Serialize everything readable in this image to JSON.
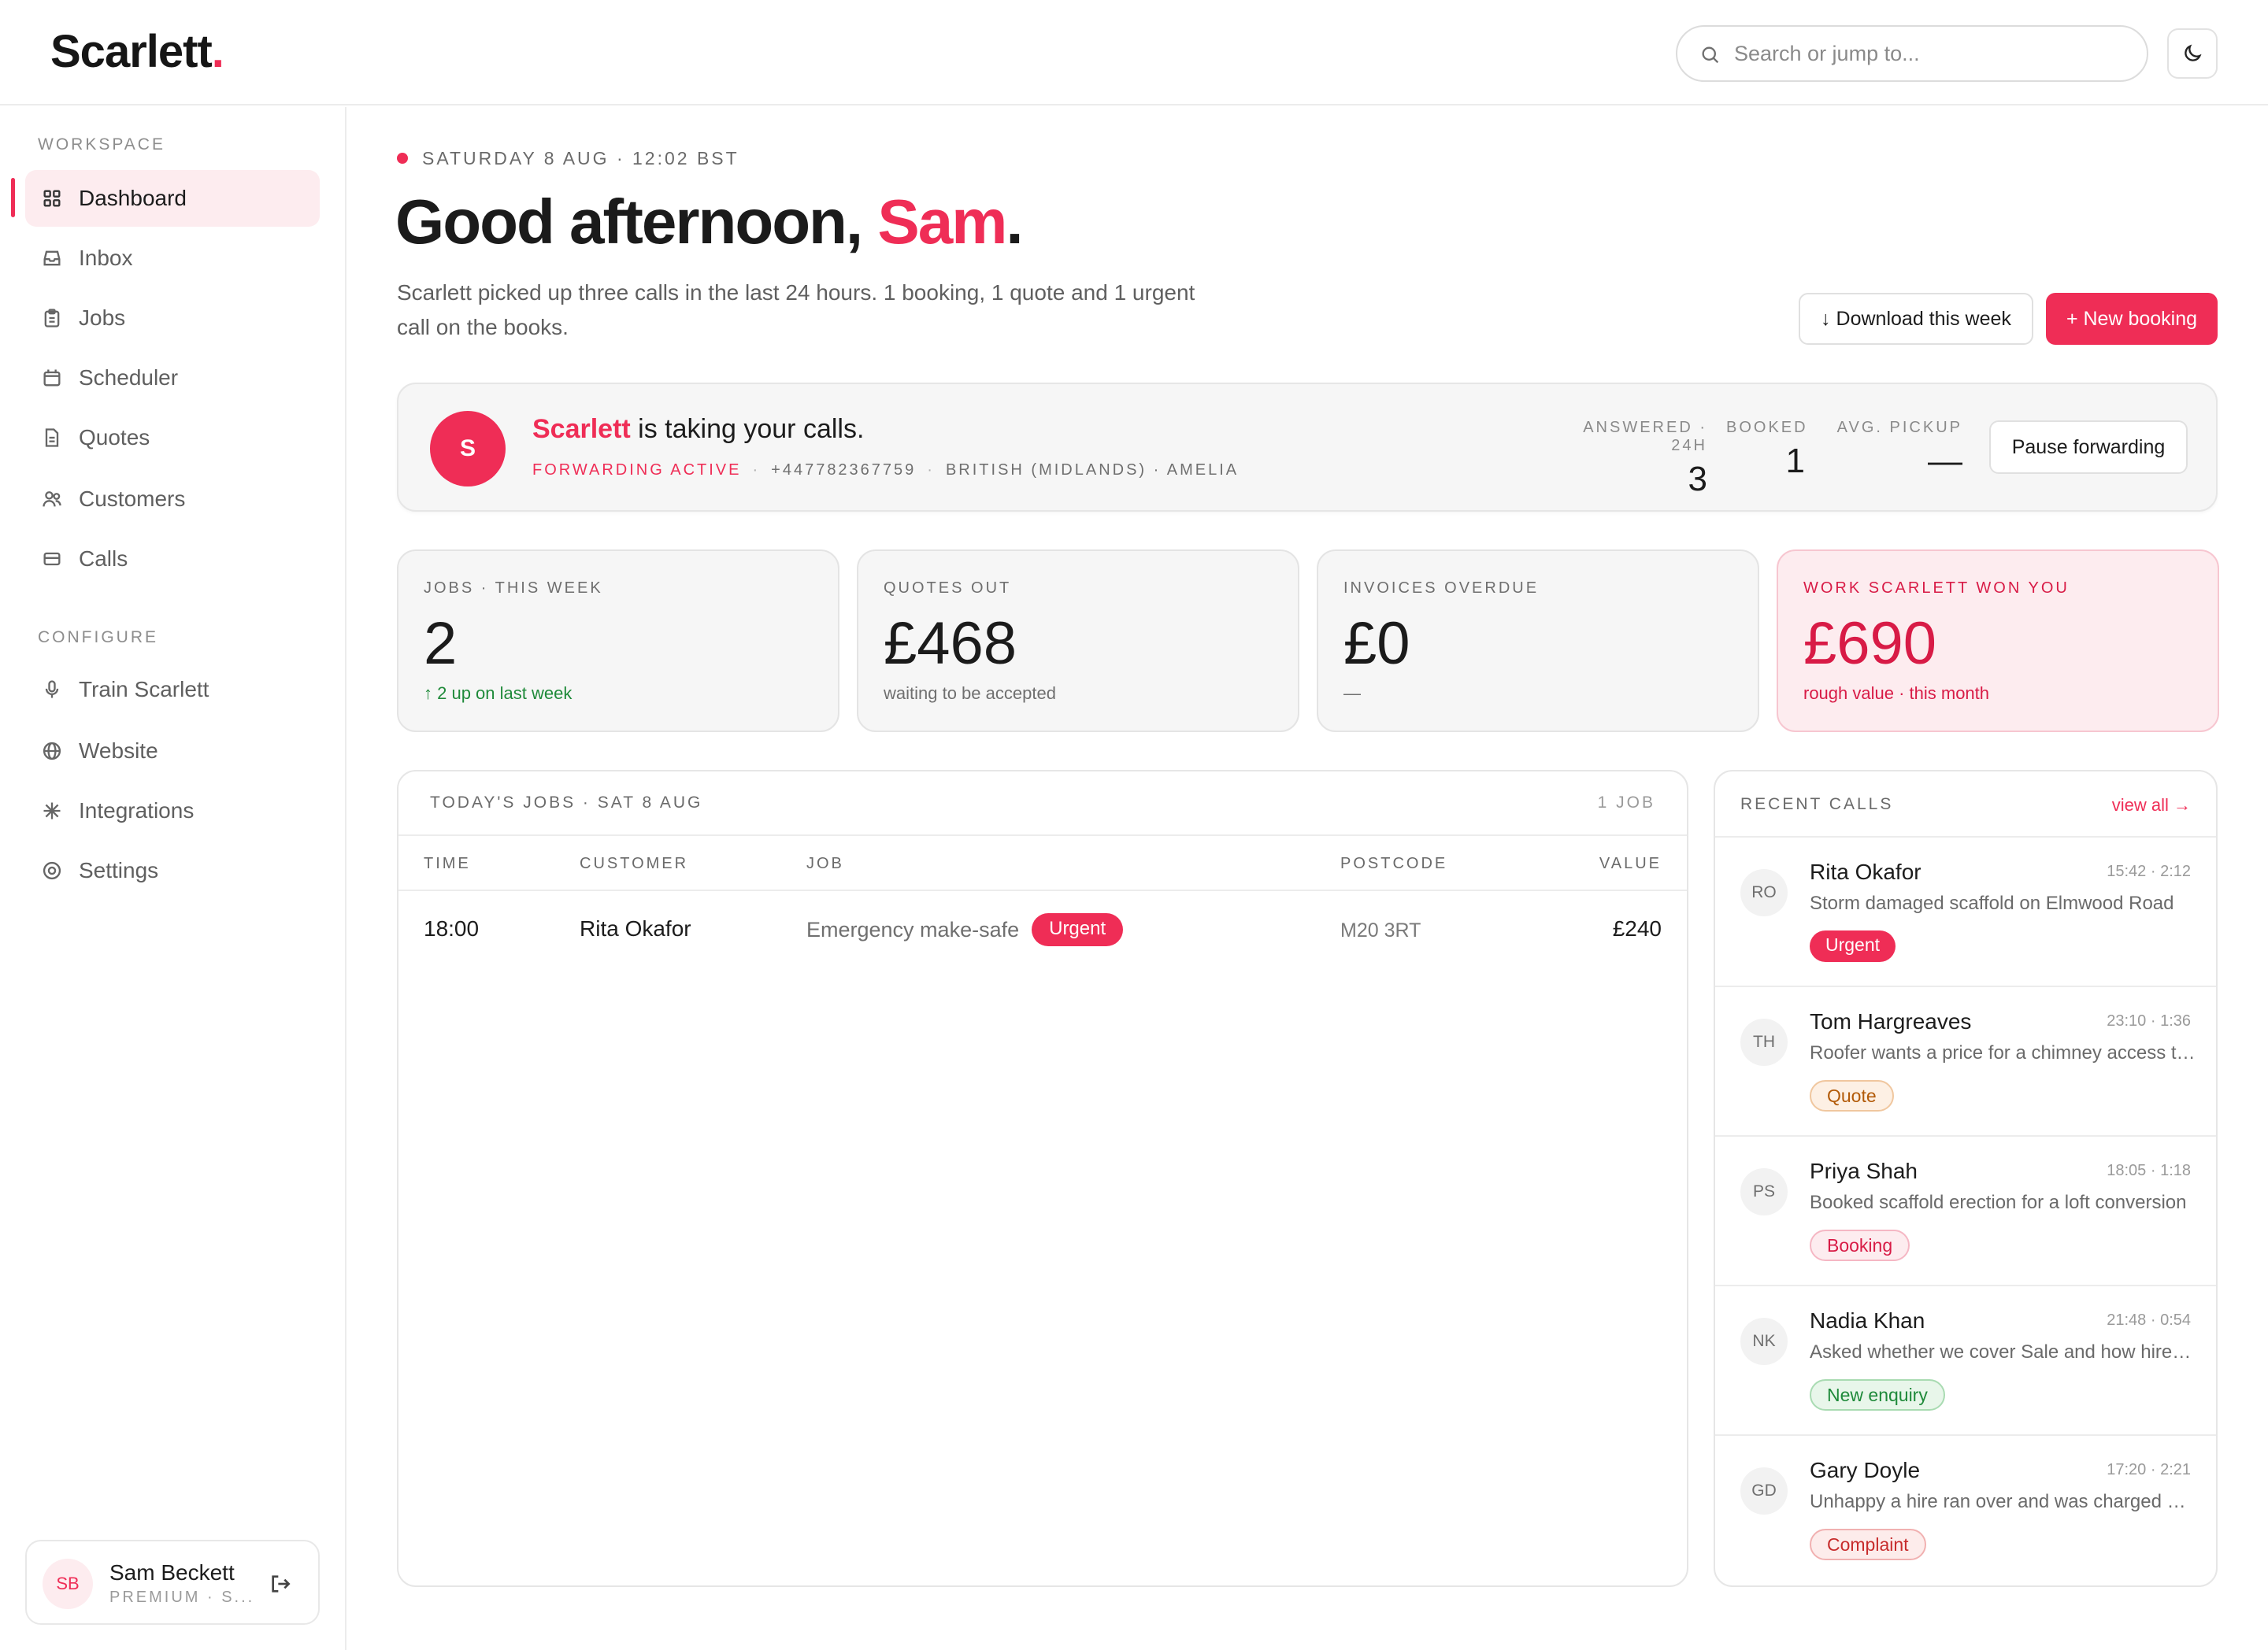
{
  "header": {
    "logo_text": "Scarlett",
    "logo_dot": ".",
    "search_placeholder": "Search or jump to..."
  },
  "sidebar": {
    "workspace_label": "WORKSPACE",
    "configure_label": "CONFIGURE",
    "workspace_items": [
      {
        "label": "Dashboard",
        "icon": "grid-icon",
        "active": true
      },
      {
        "label": "Inbox",
        "icon": "inbox-icon"
      },
      {
        "label": "Jobs",
        "icon": "clipboard-icon"
      },
      {
        "label": "Scheduler",
        "icon": "calendar-icon"
      },
      {
        "label": "Quotes",
        "icon": "document-icon"
      },
      {
        "label": "Customers",
        "icon": "users-icon"
      },
      {
        "label": "Calls",
        "icon": "card-icon"
      }
    ],
    "configure_items": [
      {
        "label": "Train Scarlett",
        "icon": "microphone-icon"
      },
      {
        "label": "Website",
        "icon": "globe-icon"
      },
      {
        "label": "Integrations",
        "icon": "sparkle-icon"
      },
      {
        "label": "Settings",
        "icon": "settings-icon"
      }
    ],
    "user": {
      "initials": "SB",
      "name": "Sam Beckett",
      "plan": "PREMIUM · S..."
    }
  },
  "main": {
    "date_line": "SATURDAY 8 AUG · 12:02 BST",
    "greeting_prefix": "Good afternoon, ",
    "greeting_name": "Sam",
    "greeting_suffix": ".",
    "summary": "Scarlett picked up three calls in the last 24 hours. 1 booking, 1 quote and 1 urgent call on the books.",
    "download_label": "↓ Download this week",
    "new_booking_label": "+ New booking"
  },
  "forwarding": {
    "avatar": "S",
    "brand": "Scarlett",
    "title_rest": " is taking your calls.",
    "status": "FORWARDING ACTIVE",
    "phone": "+447782367759",
    "voice": "BRITISH (MIDLANDS) · AMELIA",
    "separator": "·",
    "stats": [
      {
        "label": "ANSWERED · 24H",
        "value": "3"
      },
      {
        "label": "BOOKED",
        "value": "1"
      },
      {
        "label": "AVG. PICKUP",
        "value": "—"
      }
    ],
    "pause_label": "Pause forwarding"
  },
  "kpis": [
    {
      "label": "JOBS · THIS WEEK",
      "value": "2",
      "sub": "↑ 2 up on last week"
    },
    {
      "label": "QUOTES OUT",
      "value": "£468",
      "sub": "waiting to be accepted"
    },
    {
      "label": "INVOICES OVERDUE",
      "value": "£0",
      "sub": "—"
    },
    {
      "label": "WORK SCARLETT WON YOU",
      "value": "£690",
      "sub": "rough value · this month"
    }
  ],
  "jobs": {
    "title": "TODAY'S JOBS · SAT 8 AUG",
    "count": "1 JOB",
    "columns": [
      "TIME",
      "CUSTOMER",
      "JOB",
      "POSTCODE",
      "VALUE"
    ],
    "rows": [
      {
        "time": "18:00",
        "customer": "Rita Okafor",
        "job": "Emergency make-safe",
        "tag": "Urgent",
        "postcode": "M20 3RT",
        "value": "£240"
      }
    ]
  },
  "calls": {
    "title": "RECENT CALLS",
    "view_all": "view all →",
    "items": [
      {
        "initials": "RO",
        "name": "Rita Okafor",
        "time": "15:42 · 2:12",
        "desc": "Storm damaged scaffold on Elmwood Road",
        "tag": "Urgent",
        "tag_type": "urgent"
      },
      {
        "initials": "TH",
        "name": "Tom Hargreaves",
        "time": "23:10 · 1:36",
        "desc": "Roofer wants a price for a chimney access tower",
        "tag": "Quote",
        "tag_type": "quote"
      },
      {
        "initials": "PS",
        "name": "Priya Shah",
        "time": "18:05 · 1:18",
        "desc": "Booked scaffold erection for a loft conversion",
        "tag": "Booking",
        "tag_type": "booking"
      },
      {
        "initials": "NK",
        "name": "Nadia Khan",
        "time": "21:48 · 0:54",
        "desc": "Asked whether we cover Sale and how hire works",
        "tag": "New enquiry",
        "tag_type": "enquiry"
      },
      {
        "initials": "GD",
        "name": "Gary Doyle",
        "time": "17:20 · 2:21",
        "desc": "Unhappy a hire ran over and was charged again",
        "tag": "Complaint",
        "tag_type": "complaint"
      }
    ]
  },
  "colors": {
    "accent": "#ef2d56",
    "success": "#1f8a3a",
    "warning": "#b25a08"
  }
}
